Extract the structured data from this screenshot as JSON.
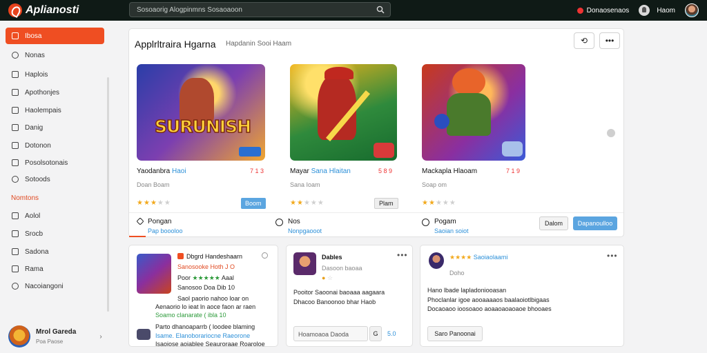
{
  "app": {
    "name": "Aplianosti",
    "search_placeholder": "Sosoaorig Alogpinmns Sosaoaoon"
  },
  "topbar": {
    "notification_label": "Donaosenaos",
    "user_label": "Haom"
  },
  "sidebar": {
    "items": [
      {
        "label": "Ibosa",
        "icon": "home-icon",
        "active": true
      },
      {
        "label": "Nonas",
        "icon": "heart-icon"
      },
      {
        "label": "Haplois",
        "icon": "user-icon"
      },
      {
        "label": "Apothonjes",
        "icon": "chart-icon"
      },
      {
        "label": "Haolempais",
        "icon": "check-icon"
      },
      {
        "label": "Danig",
        "icon": "list-icon"
      },
      {
        "label": "Dotonon",
        "icon": "bookmark-icon"
      },
      {
        "label": "Posolsotonais",
        "icon": "grid-icon"
      },
      {
        "label": "Sotoods",
        "icon": "settings-icon"
      }
    ],
    "section_label": "Nomtons",
    "section_items": [
      {
        "label": "Aolol",
        "icon": "folder-icon"
      },
      {
        "label": "Srocb",
        "icon": "play-icon"
      },
      {
        "label": "Sadona",
        "icon": "layers-icon"
      },
      {
        "label": "Rama",
        "icon": "tag-icon"
      },
      {
        "label": "Nacoiangoni",
        "icon": "help-icon"
      }
    ],
    "profile": {
      "name": "Mrol Gareda",
      "subtitle": "Poa Paose"
    }
  },
  "main": {
    "title": "Applrltraira Hgarna",
    "subtitle": "Hapdanin Sooi Haam",
    "games": [
      {
        "name": "Yaodanbra",
        "name_highlight": "Haoi",
        "price": "7 1 3",
        "meta": "Doan Boam",
        "rating": 2.5,
        "button": "Boom",
        "button_style": "blue",
        "art_text": "SURUNISH"
      },
      {
        "name": "Mayar",
        "name_highlight": "Sana Hlaitan",
        "price": "5 8 9",
        "meta": "Sana Ioam",
        "rating": 2.5,
        "button": "Plam",
        "button_style": "grey",
        "art_text": ""
      },
      {
        "name": "Mackapla",
        "name_highlight": "Hlaoam",
        "price": "7 1 9",
        "meta": "Soap om",
        "rating": 2,
        "button": "",
        "button_style": "none",
        "art_text": ""
      }
    ],
    "tabs": [
      {
        "label": "Pongan",
        "sub": "Pap boooloo",
        "active": true
      },
      {
        "label": "Nos",
        "sub": "Nonpgaooot",
        "active": false
      },
      {
        "label": "Pogam",
        "sub": "Saoian soiot",
        "active": false
      }
    ],
    "button_secondary": "Dalom",
    "button_primary": "Dapanoulloo"
  },
  "cards": [
    {
      "title": "Dbgrd Handeshaarn",
      "lines": [
        "Sanosooke Hoth J O",
        "Poor",
        "Sanosoo Doa Dib 10",
        "Saol paorio nahoo loar on",
        "Aenaorio lo ieat ln aoce faon ar raen",
        "Soamo clanarate ( ibla 10",
        "Parto dhanoaparrb ( loodee blaming",
        "Isame. Elanoborariocne Raeorone",
        "Isaoiose aoiablee Seauroraae Roaroloe"
      ],
      "stars": "★★★★★",
      "extra": "Aaal"
    },
    {
      "title": "Dables",
      "lines": [
        "Dasoon baoaa",
        "Pooitor Saoonai baoaaa aagaara",
        "Dhacoo Banoonoo bhar Haob"
      ],
      "input_placeholder": "Hoamoaoa Daoda",
      "badge": "G",
      "count": "5.0"
    },
    {
      "title": "Saoiaolaami",
      "stars": "★★★★",
      "label": "Doho",
      "lines": [
        "Hano lbade lapladoniooasan",
        "Phoclanlar igoe aooaaaaos baalaoiotlbigaas",
        "Docaoaoo ioosoaoo aoaaoaoaoaoe bhooaes"
      ],
      "button": "Saro Panoonai"
    }
  ]
}
